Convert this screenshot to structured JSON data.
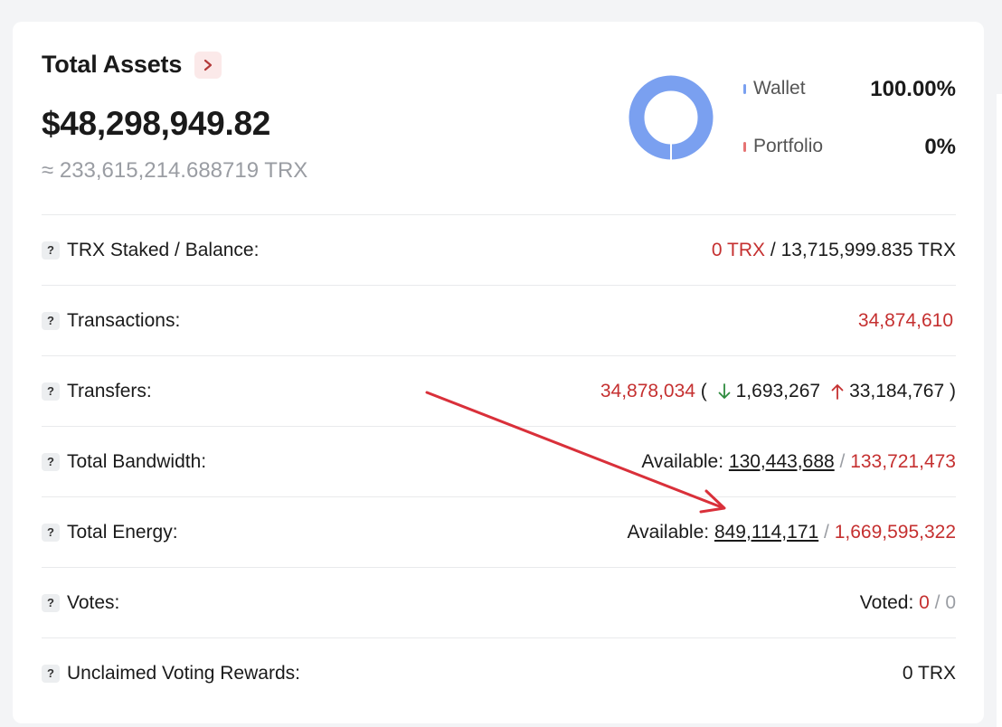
{
  "header": {
    "title": "Total Assets",
    "total_usd": "$48,298,949.82",
    "total_trx": "≈ 233,615,214.688719 TRX"
  },
  "allocation": {
    "items": [
      {
        "label": "Wallet",
        "percent": "100.00%",
        "color": "#7aa0f0",
        "fraction": 1.0
      },
      {
        "label": "Portfolio",
        "percent": "0%",
        "color": "#e57373",
        "fraction": 0.0
      }
    ]
  },
  "rows": {
    "staked": {
      "label": "TRX Staked / Balance:",
      "staked": "0 TRX",
      "separator": " / ",
      "balance": "13,715,999.835 TRX"
    },
    "transactions": {
      "label": "Transactions:",
      "value": "34,874,610"
    },
    "transfers": {
      "label": "Transfers:",
      "total": "34,878,034",
      "open": " ( ",
      "in": "1,693,267",
      "out": "33,184,767",
      "close": " )"
    },
    "bandwidth": {
      "label": "Total Bandwidth:",
      "prefix": "Available: ",
      "available": "130,443,688",
      "separator": " / ",
      "total": "133,721,473"
    },
    "energy": {
      "label": "Total Energy:",
      "prefix": "Available: ",
      "available": "849,114,171",
      "separator": " / ",
      "total": "1,669,595,322"
    },
    "votes": {
      "label": "Votes:",
      "prefix": "Voted: ",
      "voted": "0",
      "separator": " / ",
      "total": "0"
    },
    "rewards": {
      "label": "Unclaimed Voting Rewards:",
      "value": "0 TRX"
    }
  },
  "colors": {
    "accent_red": "#c53030",
    "in_green": "#2e8b3e",
    "annotation_red": "#d9303a"
  },
  "icons": [
    "chevron-right-icon",
    "question-icon",
    "arrow-down-icon",
    "arrow-up-icon"
  ]
}
